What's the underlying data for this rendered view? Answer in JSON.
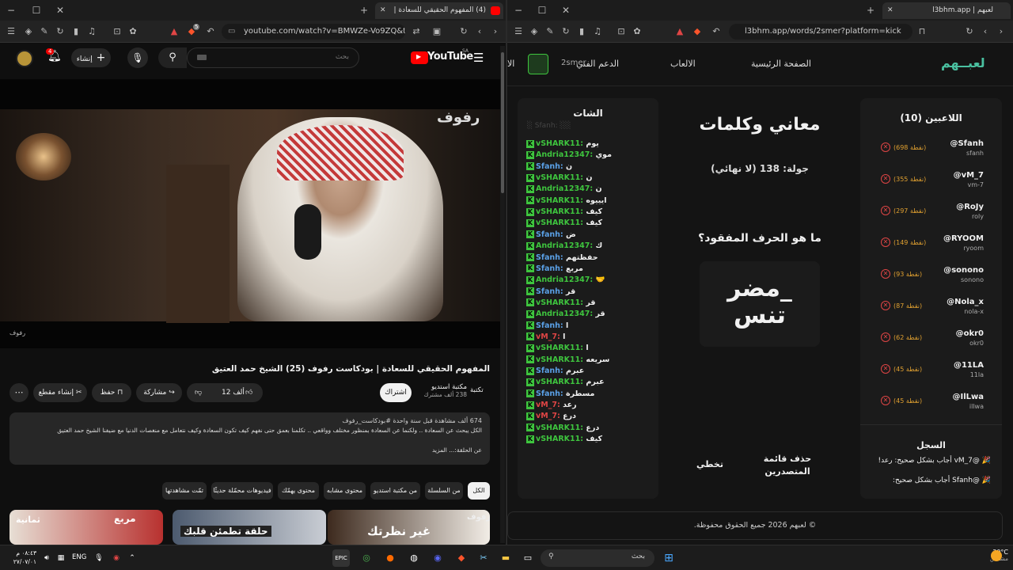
{
  "left_browser": {
    "tab_title": "(4) المفهوم الحقيقي للسعادة |",
    "url": "youtube.com/watch?v=BMWZe-Vo9ZQ&t...",
    "badge": "5"
  },
  "youtube": {
    "logo": "YouTube",
    "region": "SA",
    "search_placeholder": "بحث",
    "create_label": "إنشاء",
    "notif_count": "4",
    "watermark": "رفوف",
    "video_label": "رفوف",
    "title": "المفهوم الحقيقي للسعادة | بودكاست رفوف (25) الشيخ حمد العتيق",
    "channel": "مكتبة استديو",
    "channel_sub_prefix": "تكتبة",
    "subscribers": "238 ألف مشترك",
    "subscribe": "اشتراك",
    "likes": "12 ألف",
    "share": "مشاركة",
    "save": "حفظ",
    "clip": "إنشاء مقطع",
    "views_line": "674 ألف مشاهدة  قبل سنة واحدة  #بودكاست_رفوف",
    "desc_line": "الكل يبحث عن السعادة .. ولكنما عن السعادة بمنظور مختلف وواقعي .. تكلمنا بعمق حتى نفهم كيف تكون السعادة وكيف نتعامل مع منغصات الدنيا مع ضيفنا الشيخ حمد العتيق",
    "desc_more": "عن الحلقة:... المزيد",
    "chips": [
      "الكل",
      "من السلسلة",
      "من مكتبة استديو",
      "محتوى مشابه",
      "محتوى يهمّك",
      "فيديوهات محمّلة حديثًا",
      "تمّت مشاهدتها"
    ],
    "thumbs": [
      "رفوف",
      "غير نظرتك",
      "حلقة تطمئن قلبك",
      "مربع",
      "ثمانية"
    ]
  },
  "right_browser": {
    "tab_title": "لعبهم | l3bhm.app",
    "url": "l3bhm.app/words/2smer?platform=kick"
  },
  "site": {
    "logo": "لعبــهم",
    "nav": [
      "الصفحة الرئيسية",
      "الالعاب",
      "الدعم الفني",
      "الا"
    ],
    "user": "2smer",
    "game_title": "معاني وكلمات",
    "round": "جولة: 138 (لا نهائي)",
    "question": "ما هو الحرف المفقود؟",
    "word_line1": "مضر_",
    "word_line2": "تنس",
    "btn_delete": "حذف قائمة المتصدرين",
    "btn_skip": "تخطي",
    "footer": "© لعبهم 2026 جميع الحقوق محفوظة."
  },
  "players_title": "اللاعبين (10)",
  "players": [
    {
      "name": "@Sfanh",
      "sub": "sfanh",
      "pts": "(698 نقطة)"
    },
    {
      "name": "@vM_7",
      "sub": "vm-7",
      "pts": "(355 نقطة)"
    },
    {
      "name": "@RoJy",
      "sub": "roly",
      "pts": "(297 نقطة)"
    },
    {
      "name": "@RYOOM",
      "sub": "ryoom",
      "pts": "(149 نقطة)"
    },
    {
      "name": "@sonono",
      "sub": "sonono",
      "pts": "(93 نقطة)"
    },
    {
      "name": "@Nola_x",
      "sub": "nola-x",
      "pts": "(87 نقطة)"
    },
    {
      "name": "@okr0",
      "sub": "okr0",
      "pts": "(62 نقطة)"
    },
    {
      "name": "@11LA",
      "sub": "11la",
      "pts": "(45 نقطة)"
    },
    {
      "name": "@IlLwa",
      "sub": "illwa",
      "pts": "(45 نقطة)"
    }
  ],
  "log_title": "السجل",
  "log": [
    "🎉 @vM_7 أجاب بشكل صحيح: رعد!",
    "🎉 @Sfanh أجاب بشكل صحيح:"
  ],
  "chat_title": "الشات",
  "chat": [
    {
      "user": "vSHARK11:",
      "text": "يوم",
      "color": "#3ec53e"
    },
    {
      "user": "Andria12347:",
      "text": "موي",
      "color": "#3ec53e"
    },
    {
      "user": "Sfanh:",
      "text": "ن",
      "color": "#5aa0e6"
    },
    {
      "user": "vSHARK11:",
      "text": "ن",
      "color": "#3ec53e"
    },
    {
      "user": "Andria12347:",
      "text": "ن",
      "color": "#3ec53e"
    },
    {
      "user": "vSHARK11:",
      "text": "ايييوه",
      "color": "#3ec53e"
    },
    {
      "user": "vSHARK11:",
      "text": "كيف",
      "color": "#3ec53e"
    },
    {
      "user": "vSHARK11:",
      "text": "كيف",
      "color": "#3ec53e"
    },
    {
      "user": "Sfanh:",
      "text": "ض",
      "color": "#5aa0e6"
    },
    {
      "user": "Andria12347:",
      "text": "ك",
      "color": "#3ec53e"
    },
    {
      "user": "Sfanh:",
      "text": "حفظتهم",
      "color": "#5aa0e6"
    },
    {
      "user": "Sfanh:",
      "text": "مربع",
      "color": "#5aa0e6"
    },
    {
      "user": "Andria12347:",
      "text": "🤝",
      "color": "#3ec53e"
    },
    {
      "user": "Sfanh:",
      "text": "قر",
      "color": "#5aa0e6"
    },
    {
      "user": "vSHARK11:",
      "text": "قر",
      "color": "#3ec53e"
    },
    {
      "user": "Andria12347:",
      "text": "قر",
      "color": "#3ec53e"
    },
    {
      "user": "Sfanh:",
      "text": "ا",
      "color": "#5aa0e6"
    },
    {
      "user": "vM_7:",
      "text": "ا",
      "color": "#e04545"
    },
    {
      "user": "vSHARK11:",
      "text": "ا",
      "color": "#3ec53e"
    },
    {
      "user": "vSHARK11:",
      "text": "سريعه",
      "color": "#3ec53e"
    },
    {
      "user": "Sfanh:",
      "text": "عبرم",
      "color": "#5aa0e6"
    },
    {
      "user": "vSHARK11:",
      "text": "عبرم",
      "color": "#3ec53e"
    },
    {
      "user": "Sfanh:",
      "text": "مسطرة",
      "color": "#5aa0e6"
    },
    {
      "user": "vM_7:",
      "text": "رعد",
      "color": "#e04545"
    },
    {
      "user": "vM_7:",
      "text": "درع",
      "color": "#e04545"
    },
    {
      "user": "vSHARK11:",
      "text": "درع",
      "color": "#3ec53e"
    },
    {
      "user": "vSHARK11:",
      "text": "كيف",
      "color": "#3ec53e"
    }
  ],
  "taskbar": {
    "search": "بحث",
    "lang": "ENG",
    "time": "٠٨:٤٣ م",
    "date": "٢٧/٠٧/٠١",
    "weather_temp": "30°C",
    "weather_desc": "مشمس"
  }
}
